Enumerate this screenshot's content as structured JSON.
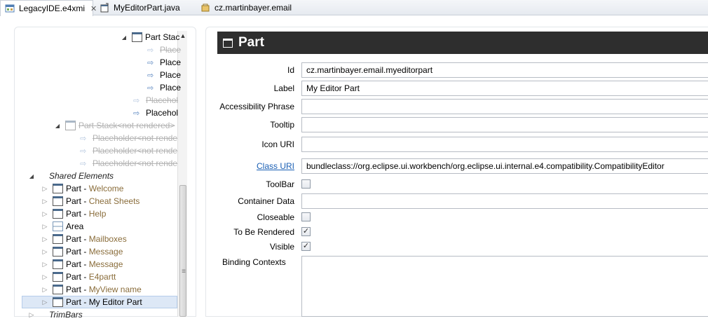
{
  "tabs": [
    {
      "label": "LegacyIDE.e4xmi",
      "icon": "e4xmi-icon",
      "active": true,
      "closable": true
    },
    {
      "label": "MyEditorPart.java",
      "icon": "java-class-icon",
      "active": false
    },
    {
      "label": "cz.martinbayer.email",
      "icon": "package-icon",
      "active": false
    }
  ],
  "tree": {
    "part_stack_label": "Part Stac",
    "placeholder_faded_1": "Place",
    "placeholder_2": "Place",
    "placeholder_3": "Place",
    "placeholder_4": "Place",
    "placeholder_faded_5": "Placehol",
    "placeholder_6": "Placehol",
    "part_stack_not_rendered": "Part Stack<not rendered>",
    "ph_not_rendered_1": "Placeholder<not rende",
    "ph_not_rendered_2": "Placeholder<not rende",
    "ph_not_rendered_3": "Placeholder<not rende",
    "shared_elements": "Shared Elements",
    "parts": [
      {
        "prefix": "Part",
        "sep": " - ",
        "name": "Welcome"
      },
      {
        "prefix": "Part",
        "sep": " - ",
        "name": "Cheat Sheets"
      },
      {
        "prefix": "Part",
        "sep": " - ",
        "name": "Help"
      },
      {
        "prefix": "Area",
        "sep": "",
        "name": ""
      },
      {
        "prefix": "Part",
        "sep": " - ",
        "name": "Mailboxes"
      },
      {
        "prefix": "Part",
        "sep": " - ",
        "name": "Message"
      },
      {
        "prefix": "Part",
        "sep": " - ",
        "name": "Message"
      },
      {
        "prefix": "Part",
        "sep": " - ",
        "name": "E4partt"
      },
      {
        "prefix": "Part",
        "sep": " - ",
        "name": "MyView name"
      },
      {
        "prefix": "Part",
        "sep": " - ",
        "name": "My Editor Part"
      }
    ],
    "trimbars": "TrimBars"
  },
  "editor": {
    "title": "Part",
    "fields": {
      "id_label": "Id",
      "id_value": "cz.martinbayer.email.myeditorpart",
      "label_label": "Label",
      "label_value": "My Editor Part",
      "accessibility_label": "Accessibility Phrase",
      "accessibility_value": "",
      "tooltip_label": "Tooltip",
      "tooltip_value": "",
      "icon_uri_label": "Icon URI",
      "icon_uri_value": "",
      "class_uri_label": "Class URI",
      "class_uri_value": "bundleclass://org.eclipse.ui.workbench/org.eclipse.ui.internal.e4.compatibility.CompatibilityEditor",
      "toolbar_label": "ToolBar",
      "toolbar_checked": false,
      "container_data_label": "Container Data",
      "container_data_value": "",
      "closeable_label": "Closeable",
      "closeable_checked": false,
      "to_be_rendered_label": "To Be Rendered",
      "to_be_rendered_checked": true,
      "visible_label": "Visible",
      "visible_checked": true,
      "binding_contexts_label": "Binding Contexts"
    }
  }
}
